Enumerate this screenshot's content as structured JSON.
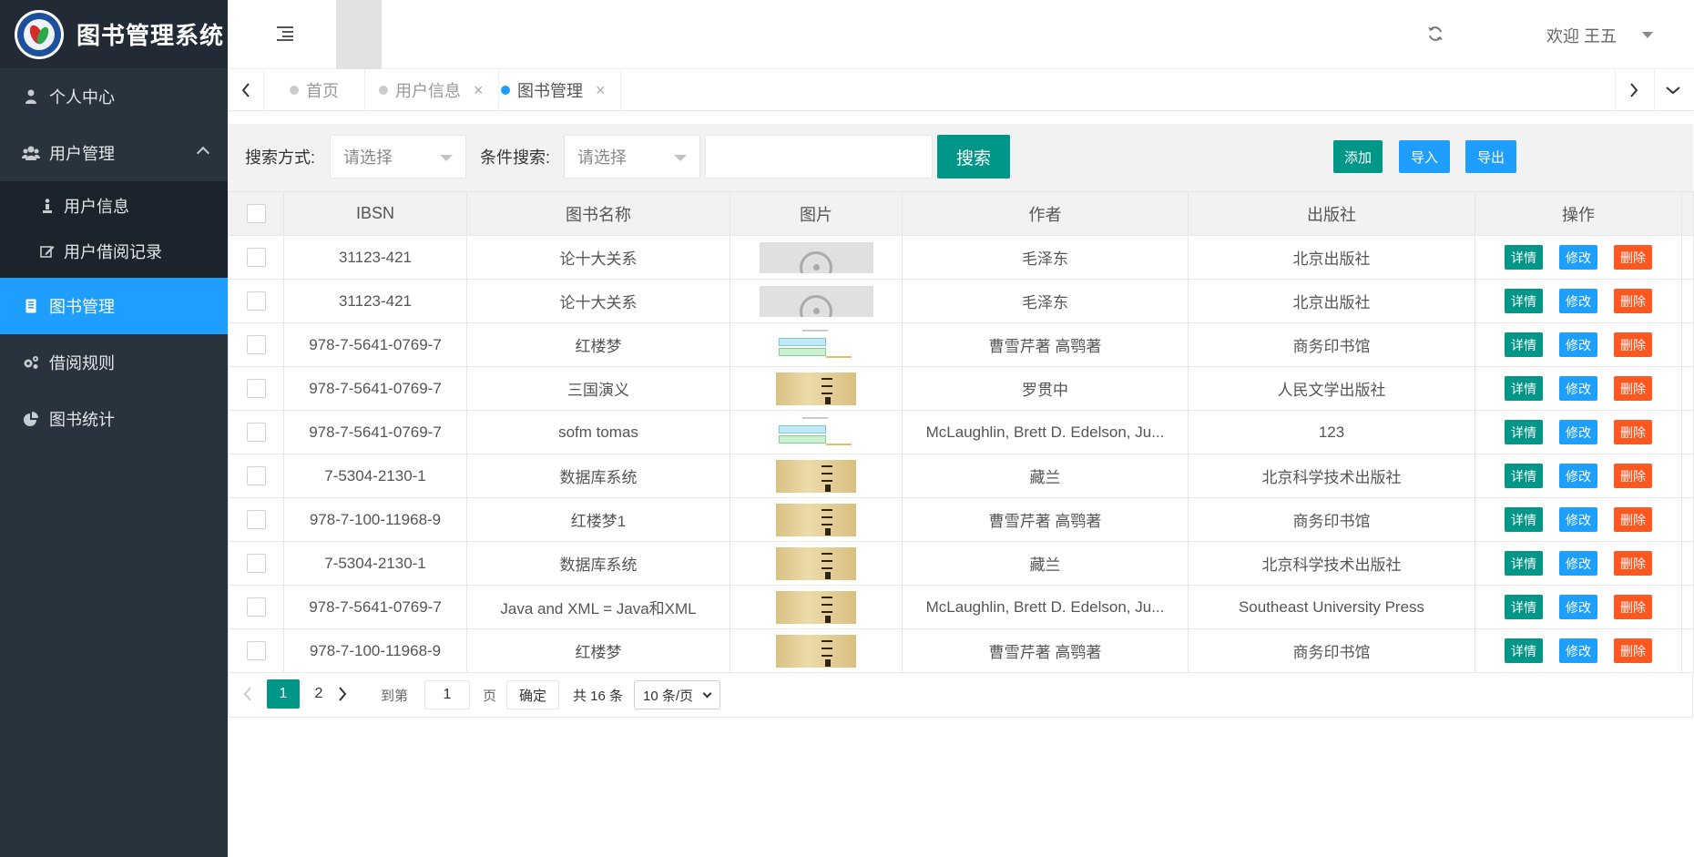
{
  "app": {
    "title": "图书管理系统"
  },
  "sidebar": {
    "items": [
      {
        "label": "个人中心",
        "icon": "user-icon"
      },
      {
        "label": "用户管理",
        "icon": "users-icon"
      },
      {
        "label": "用户信息",
        "icon": "user-info-icon"
      },
      {
        "label": "用户借阅记录",
        "icon": "edit-icon"
      },
      {
        "label": "图书管理",
        "icon": "book-icon"
      },
      {
        "label": "借阅规则",
        "icon": "gears-icon"
      },
      {
        "label": "图书统计",
        "icon": "pie-chart-icon"
      }
    ]
  },
  "header": {
    "welcome": "欢迎 王五"
  },
  "tabs": [
    {
      "label": "首页"
    },
    {
      "label": "用户信息",
      "close": "×"
    },
    {
      "label": "图书管理",
      "close": "×"
    }
  ],
  "toolbar": {
    "search_mode_label": "搜索方式:",
    "search_mode_value": "请选择",
    "condition_label": "条件搜索:",
    "condition_value": "请选择",
    "search_button": "搜索",
    "add_button": "添加",
    "import_button": "导入",
    "export_button": "导出"
  },
  "table": {
    "columns": [
      "IBSN",
      "图书名称",
      "图片",
      "作者",
      "出版社",
      "操作"
    ],
    "actions": {
      "detail": "详情",
      "edit": "修改",
      "delete": "删除"
    },
    "rows": [
      {
        "ibsn": "31123-421",
        "name": "论十大关系",
        "image": "placeholder",
        "author": "毛泽东",
        "publisher": "北京出版社"
      },
      {
        "ibsn": "31123-421",
        "name": "论十大关系",
        "image": "placeholder",
        "author": "毛泽东",
        "publisher": "北京出版社"
      },
      {
        "ibsn": "978-7-5641-0769-7",
        "name": "红楼梦",
        "image": "diagram",
        "author": "曹雪芹著 高鹗著",
        "publisher": "商务印书馆"
      },
      {
        "ibsn": "978-7-5641-0769-7",
        "name": "三国演义",
        "image": "book",
        "author": "罗贯中",
        "publisher": "人民文学出版社"
      },
      {
        "ibsn": "978-7-5641-0769-7",
        "name": "sofm tomas",
        "image": "diagram",
        "author": "McLaughlin, Brett D. Edelson, Ju...",
        "publisher": "123"
      },
      {
        "ibsn": "7-5304-2130-1",
        "name": "数据库系统",
        "image": "book",
        "author": "藏兰",
        "publisher": "北京科学技术出版社"
      },
      {
        "ibsn": "978-7-100-11968-9",
        "name": "红楼梦1",
        "image": "book",
        "author": "曹雪芹著 高鹗著",
        "publisher": "商务印书馆"
      },
      {
        "ibsn": "7-5304-2130-1",
        "name": "数据库系统",
        "image": "book",
        "author": "藏兰",
        "publisher": "北京科学技术出版社"
      },
      {
        "ibsn": "978-7-5641-0769-7",
        "name": "Java and XML = Java和XML",
        "image": "book",
        "author": "McLaughlin, Brett D. Edelson, Ju...",
        "publisher": "Southeast University Press"
      },
      {
        "ibsn": "978-7-100-11968-9",
        "name": "红楼梦",
        "image": "book",
        "author": "曹雪芹著 高鹗著",
        "publisher": "商务印书馆"
      }
    ]
  },
  "pagination": {
    "pages": [
      "1",
      "2"
    ],
    "goto_label": "到第",
    "goto_value": "1",
    "page_unit": "页",
    "confirm": "确定",
    "total": "共 16 条",
    "page_size": "10 条/页"
  },
  "colors": {
    "primary": "#009688",
    "blue": "#1e9fff",
    "danger": "#ff5722",
    "sidebar": "#28333e"
  }
}
